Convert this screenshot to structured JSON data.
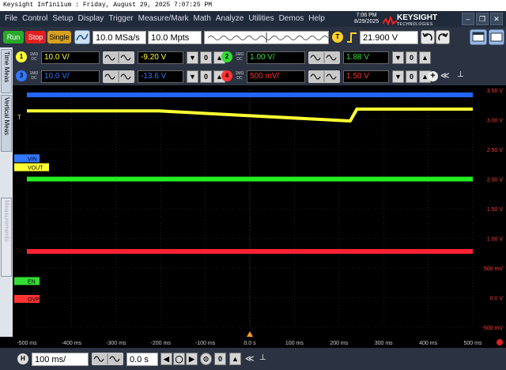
{
  "window": {
    "title": "Keysight Infiniium : Friday, August 29, 2025 7:07:25 PM"
  },
  "menu": {
    "items": [
      "File",
      "Control",
      "Setup",
      "Display",
      "Trigger",
      "Measure/Mark",
      "Math",
      "Analyze",
      "Utilities",
      "Demos",
      "Help"
    ],
    "time": "7:06 PM",
    "date": "8/29/2025",
    "brand": "KEYSIGHT",
    "brand_sub": "TECHNOLOGIES"
  },
  "toolbar": {
    "run": "Run",
    "stop": "Stop",
    "single": "Single",
    "sample_rate": "10.0 MSa/s",
    "memory_depth": "10.0 Mpts",
    "trigger_badge": "T",
    "trigger_level": "21.900 V"
  },
  "channels": [
    {
      "badge": "1",
      "coupling_top": "1MΩ",
      "coupling_bottom": "DC",
      "scale": "10.0 V/",
      "offset": "-9.20 V",
      "color": "#ffff33"
    },
    {
      "badge": "2",
      "coupling_top": "1MΩ",
      "coupling_bottom": "DC",
      "scale": "1.00 V/",
      "offset": "1.88 V",
      "color": "#33dd33"
    },
    {
      "badge": "3",
      "coupling_top": "1MΩ",
      "coupling_bottom": "DC",
      "scale": "10.0 V/",
      "offset": "-13.6 V",
      "color": "#3377ff"
    },
    {
      "badge": "4",
      "coupling_top": "1MΩ",
      "coupling_bottom": "DC",
      "scale": "500 mV/",
      "offset": "1.50 V",
      "color": "#ff3333"
    }
  ],
  "sidebar": {
    "tabs": [
      "Time Meas",
      "Vertical Meas",
      "Measurements"
    ]
  },
  "markers": {
    "vin": "VIN",
    "vout": "VOUT",
    "en": "EN",
    "ovp": "OVP",
    "trig": "T"
  },
  "bottom": {
    "h_badge": "H",
    "h_scale": "100 ms/",
    "h_delay": "0.0 s"
  },
  "chart_data": {
    "type": "line",
    "xlim": [
      -500,
      500
    ],
    "x_unit": "ms",
    "x_ticks": [
      "-500 ms",
      "-400 ms",
      "-300 ms",
      "-200 ms",
      "-100 ms",
      "0.0 s",
      "100 ms",
      "200 ms",
      "300 ms",
      "400 ms",
      "500 ms"
    ],
    "y_ticks_right": [
      "3.50 V",
      "3.00 V",
      "2.50 V",
      "2.00 V",
      "1.50 V",
      "1.00 V",
      "500 mV",
      "0.0 V",
      "-500 mV"
    ],
    "grid": true,
    "series": [
      {
        "name": "VIN",
        "color": "#2266ff",
        "x": [
          -500,
          500
        ],
        "y": [
          3.42,
          3.42
        ]
      },
      {
        "name": "VOUT",
        "color": "#ffff33",
        "x": [
          -500,
          -205,
          225,
          240,
          500
        ],
        "y": [
          3.15,
          3.15,
          2.98,
          3.18,
          3.18
        ]
      },
      {
        "name": "EN",
        "color": "#22ee22",
        "x": [
          -500,
          500
        ],
        "y": [
          2.0,
          2.0
        ]
      },
      {
        "name": "OVP",
        "color": "#ff2233",
        "x": [
          -500,
          500
        ],
        "y": [
          0.78,
          0.78
        ]
      }
    ]
  }
}
